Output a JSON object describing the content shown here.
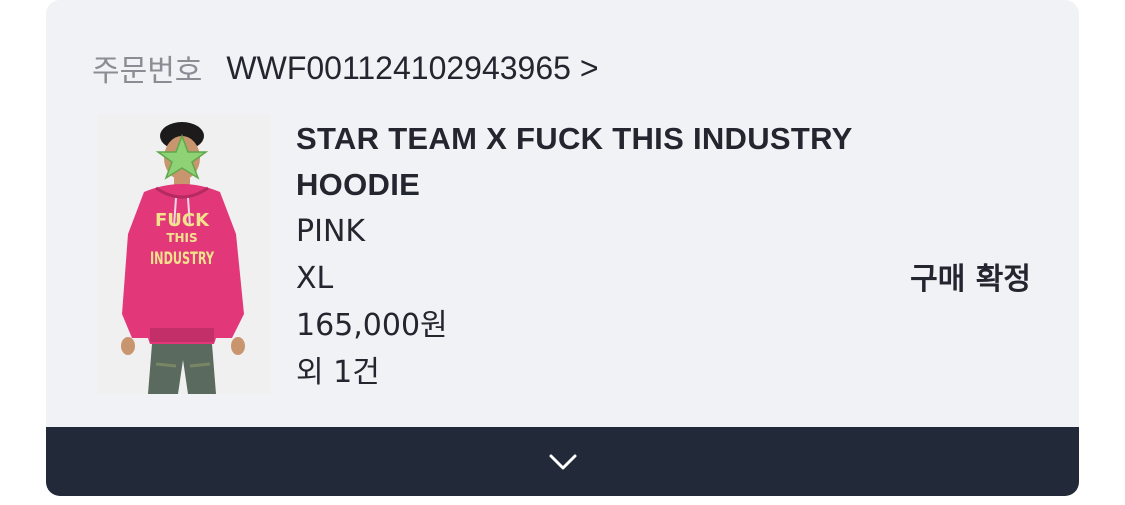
{
  "order": {
    "label": "주문번호",
    "number": "WWF001124102943965 >"
  },
  "product": {
    "name": "STAR TEAM X FUCK THIS INDUSTRY HOODIE",
    "color": "PINK",
    "size": "XL",
    "price": "165,000원",
    "extra_count": "외 1건",
    "image_text": [
      "FUCK",
      "THIS",
      "INDUSTRY"
    ]
  },
  "status": {
    "label": "구매 확정"
  },
  "expand": {
    "icon": "chevron-down-icon"
  },
  "colors": {
    "card_bg": "#f1f2f6",
    "bar_bg": "#222939",
    "hoodie": "#e2387a",
    "text": "#23262e",
    "muted": "#8a8d94"
  }
}
